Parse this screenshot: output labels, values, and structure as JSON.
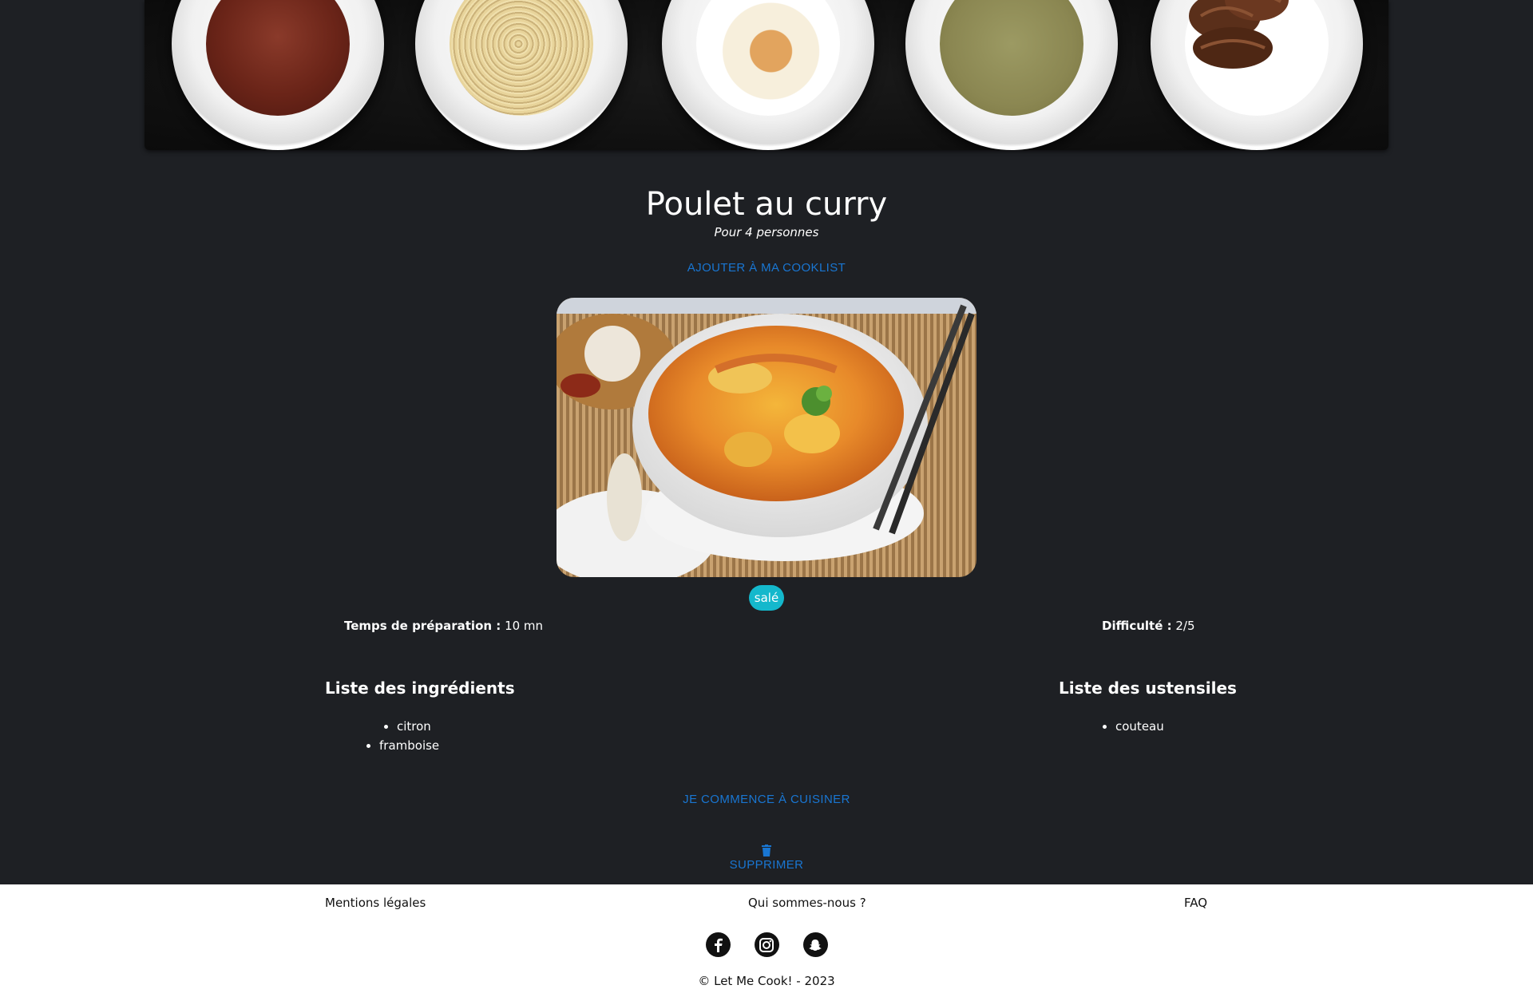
{
  "recipe": {
    "title": "Poulet au curry",
    "servings": "Pour 4 personnes",
    "add_button": "AJOUTER À MA COOKLIST",
    "tag": "salé",
    "prep_label": "Temps de préparation :",
    "prep_value": "10 mn",
    "difficulty_label": "Difficulté :",
    "difficulty_value": "2/5",
    "ingredients_title": "Liste des ingrédients",
    "ingredients": [
      "citron",
      "framboise"
    ],
    "utensils_title": "Liste des ustensiles",
    "utensils": [
      "couteau"
    ],
    "cook_button": "JE COMMENCE À CUISINER",
    "delete_button": "SUPPRIMER"
  },
  "footer": {
    "links": [
      "Mentions légales",
      "Qui sommes-nous ?",
      "FAQ"
    ],
    "socials": [
      "facebook-icon",
      "instagram-icon",
      "snapchat-icon"
    ],
    "copyright": "© Let Me Cook! - 2023"
  },
  "colors": {
    "background": "#1e2024",
    "accent": "#1976d2",
    "tag": "#14b8cc",
    "footer": "#ffffff"
  }
}
